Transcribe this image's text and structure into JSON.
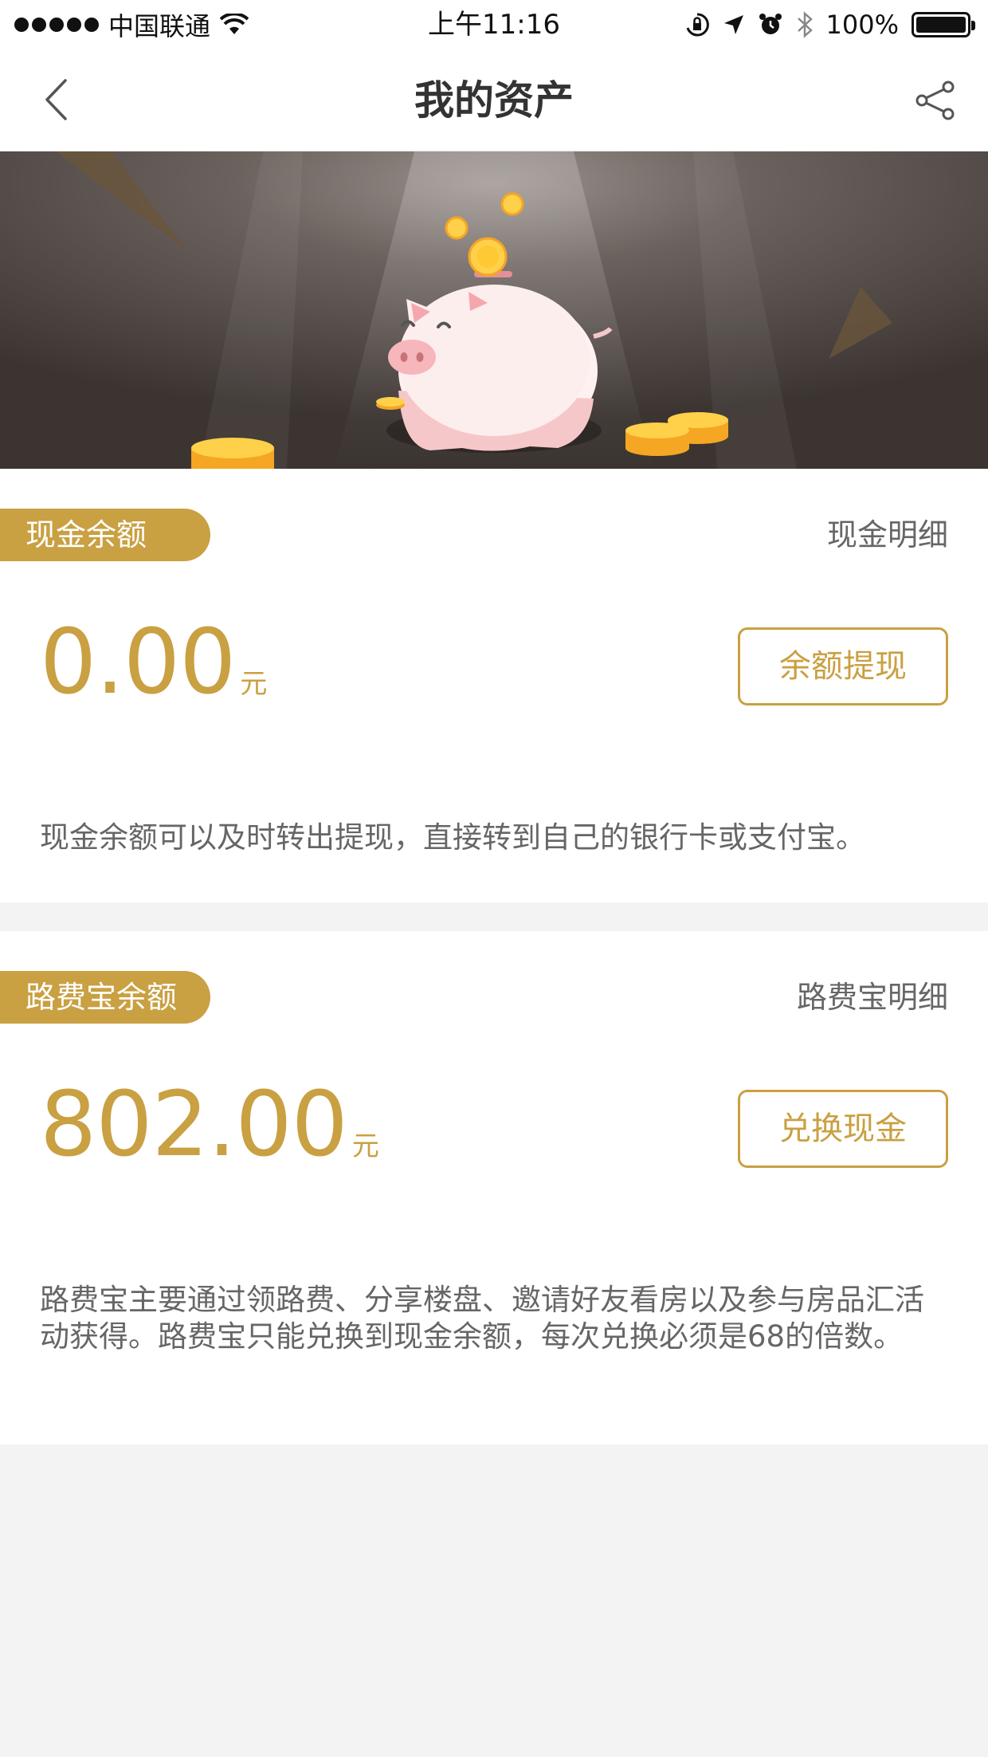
{
  "status_bar": {
    "carrier": "中国联通",
    "time": "上午11:16",
    "battery": "100%",
    "icons": [
      "signal-dots-icon",
      "wifi-icon",
      "orientation-lock-icon",
      "location-arrow-icon",
      "alarm-icon",
      "bluetooth-icon",
      "battery-icon"
    ]
  },
  "nav": {
    "title": "我的资产",
    "back_icon": "chevron-left-icon",
    "share_icon": "share-icon"
  },
  "colors": {
    "accent": "#c9a042",
    "banner_bg": "#3f3835",
    "coin": "#ffc93c",
    "pig": "#fde8e8"
  },
  "cash": {
    "tag": "现金余额",
    "detail_link": "现金明细",
    "amount": "0.00",
    "unit": "元",
    "button": "余额提现",
    "description": "现金余额可以及时转出提现，直接转到自己的银行卡或支付宝。"
  },
  "lufeibao": {
    "tag": "路费宝余额",
    "detail_link": "路费宝明细",
    "amount": "802.00",
    "unit": "元",
    "button": "兑换现金",
    "description": "路费宝主要通过领路费、分享楼盘、邀请好友看房以及参与房品汇活动获得。路费宝只能兑换到现金余额，每次兑换必须是68的倍数。"
  }
}
